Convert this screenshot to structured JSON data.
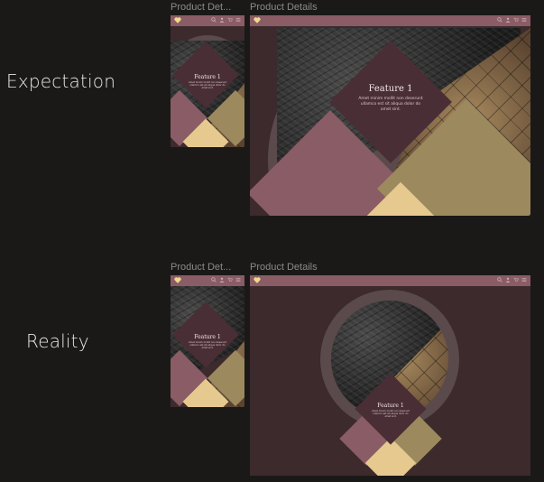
{
  "labels": {
    "expectation": "Expectation",
    "reality": "Reality"
  },
  "frames": {
    "mobile_title": "Product Det...",
    "desktop_title": "Product Details"
  },
  "feature": {
    "title": "Feature 1",
    "text": "Amet minim mollit non deserunt ullamco est sit aliqua dolor do amet sint."
  },
  "colors": {
    "background": "#1a1918",
    "page": "#3c2a2c",
    "topbar": "#8a5c66",
    "mauve": "#8a5c66",
    "olive": "#9c8a5e",
    "sand": "#e6c98f",
    "feature_box": "#4a2e35"
  },
  "icons": [
    "heart-logo-icon",
    "search-icon",
    "user-icon",
    "cart-icon",
    "menu-icon"
  ]
}
